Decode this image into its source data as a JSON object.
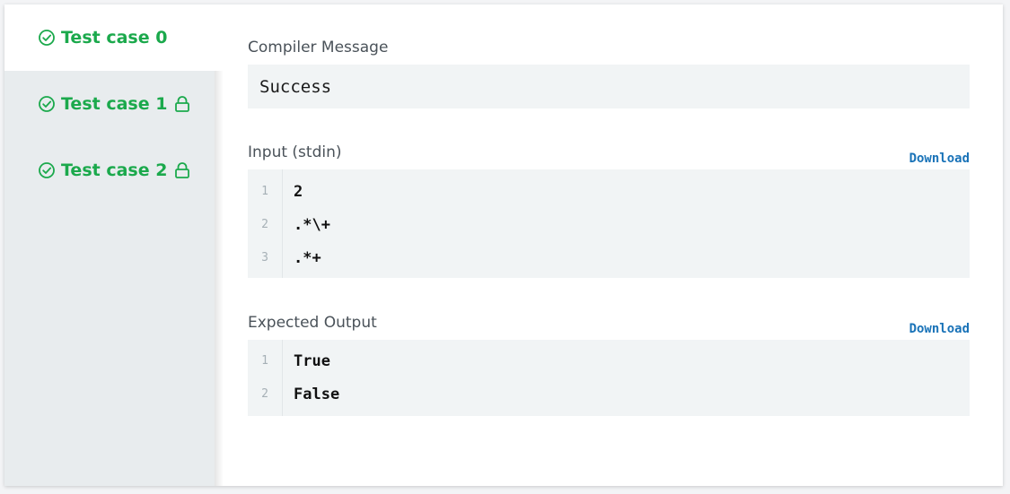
{
  "tabs": [
    {
      "label": "Test case 0",
      "locked": false
    },
    {
      "label": "Test case 1",
      "locked": true
    },
    {
      "label": "Test case 2",
      "locked": true
    }
  ],
  "compiler": {
    "label": "Compiler Message",
    "message": "Success"
  },
  "input": {
    "label": "Input (stdin)",
    "download": "Download",
    "lines": [
      {
        "num": "1",
        "text": "2"
      },
      {
        "num": "2",
        "text": ".*\\+"
      },
      {
        "num": "3",
        "text": ".*+"
      }
    ]
  },
  "expected": {
    "label": "Expected Output",
    "download": "Download",
    "lines": [
      {
        "num": "1",
        "text": "True"
      },
      {
        "num": "2",
        "text": "False"
      }
    ]
  },
  "colors": {
    "success": "#1ba94c",
    "link": "#1a73b8",
    "code_bg": "#f1f4f5",
    "sidebar_bg": "#e8ecee"
  },
  "icons": {
    "status": "check-circle-icon",
    "locked": "lock-icon"
  }
}
